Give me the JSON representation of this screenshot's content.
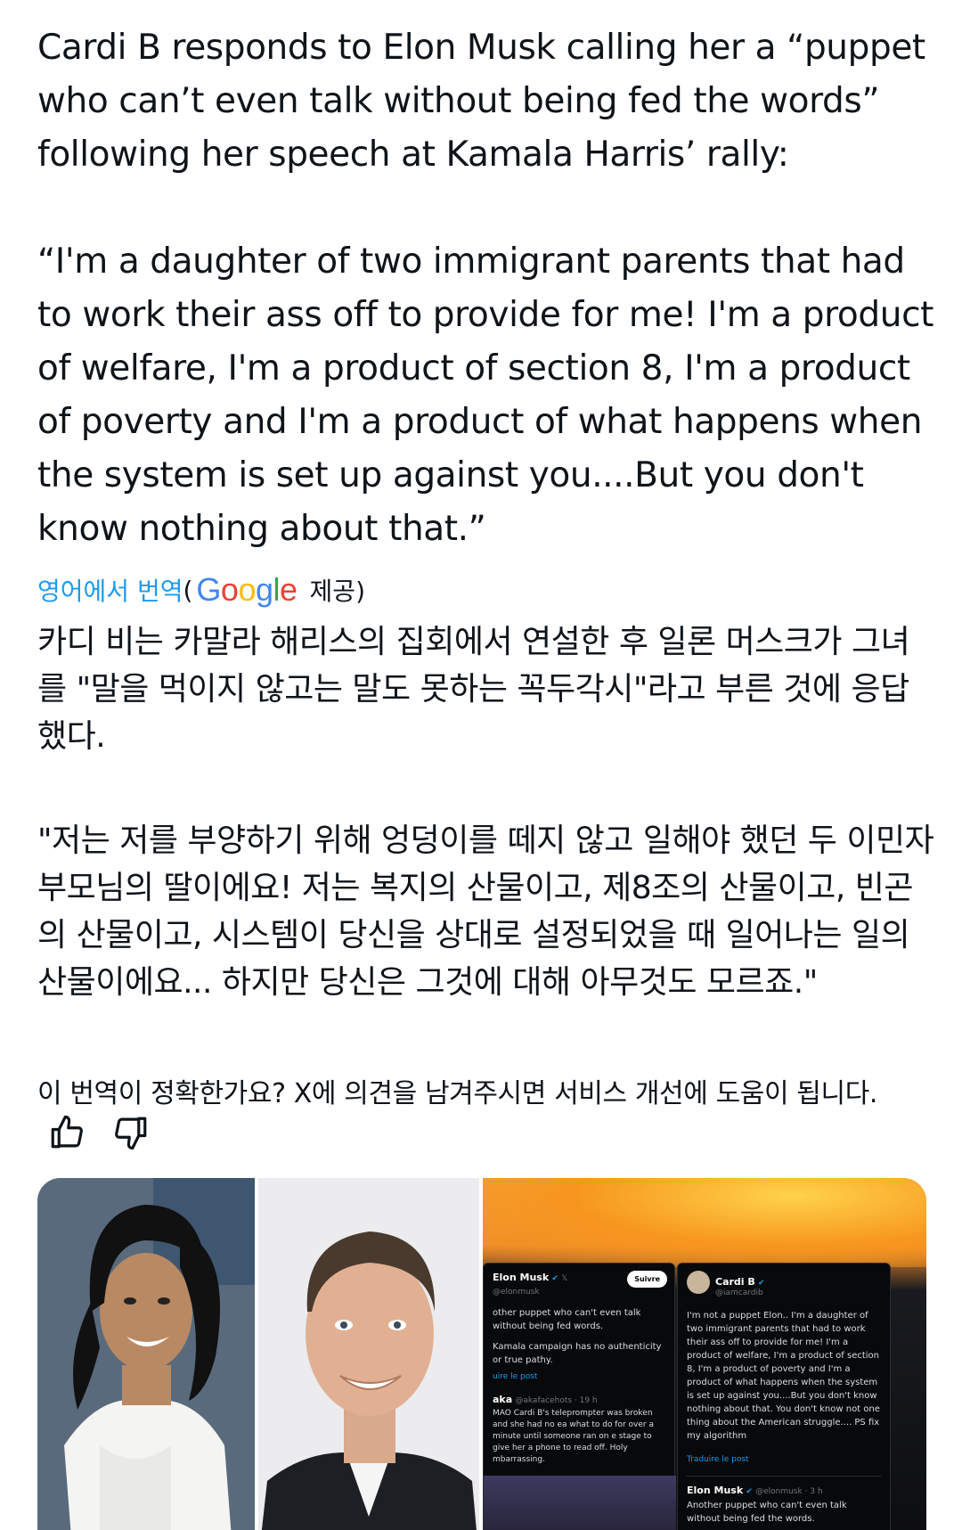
{
  "post": {
    "headline": "Cardi B responds to Elon Musk calling her a “puppet who can’t even talk without being fed the words” following her speech at Kamala Harris’ rally:",
    "quote": "“I'm a daughter of two immigrant parents that had to work their ass off to provide for me! I'm a product of welfare, I'm a product of section 8, I'm a product of poverty and I'm a product of what happens when the system is set up against you....But you don't know nothing about that.”"
  },
  "translation": {
    "link_label": "영어에서 번역",
    "open_paren": "(",
    "google_letters": [
      "G",
      "o",
      "o",
      "g",
      "l",
      "e"
    ],
    "provided_label": "제공)",
    "headline_ko": "카디 비는 카말라 해리스의 집회에서 연설한 후 일론 머스크가 그녀를 \"말을 먹이지 않고는 말도 못하는 꼭두각시\"라고 부른 것에 응답했다.",
    "quote_ko": "\"저는 저를 부양하기 위해 엉덩이를 떼지 않고 일해야 했던 두 이민자 부모님의 딸이에요! 저는 복지의 산물이고, 제8조의 산물이고, 빈곤의 산물이고, 시스템이 당신을 상대로 설정되었을 때 일어나는 일의 산물이에요... 하지만 당신은 그것에 대해 아무것도 모르죠.\""
  },
  "feedback": {
    "question": "이 번역이 정확한가요? X에 의견을 남겨주시면 서비스 개선에 도움이 됩니다.",
    "icons": [
      "thumbs-up-icon",
      "thumbs-down-icon"
    ]
  },
  "media": {
    "screenshot": {
      "left_card": {
        "name": "Elon Musk",
        "handle": "@elonmusk",
        "follow": "Suivre",
        "text1": "other puppet who can't even talk without being fed words.",
        "text2": "Kamala campaign has no authenticity or true pathy.",
        "translate": "uire le post",
        "reply_name": "aka",
        "reply_handle": "@akafacehots · 19 h",
        "reply_text": "MAO Cardi B's teleprompter was broken and she had no ea what to do for over a minute until someone ran on e stage to give her a phone to read off. Holy mbarrassing."
      },
      "right_card": {
        "name": "Cardi B",
        "handle": "@iamcardib",
        "text": "I'm not a puppet Elon.. I'm a daughter of two immigrant parents that had to work their ass off to provide for me! I'm a product of welfare, I'm a product of section 8, I'm a product of poverty and I'm a product of what happens when the system is set up against you....But you don't know nothing about that. You don't know not one thing about the American struggle.... PS fix my algorithm",
        "translate": "Traduire le post",
        "nested_name": "Elon Musk",
        "nested_handle": "@elonmusk · 3 h",
        "nested_text": "Another puppet who can't even talk without being fed the words."
      }
    }
  },
  "colors": {
    "link": "#1d9bf0",
    "text": "#0f1419",
    "google_blue": "#4285f4",
    "google_red": "#ea4335",
    "google_yellow": "#fbbc05",
    "google_green": "#34a853"
  }
}
